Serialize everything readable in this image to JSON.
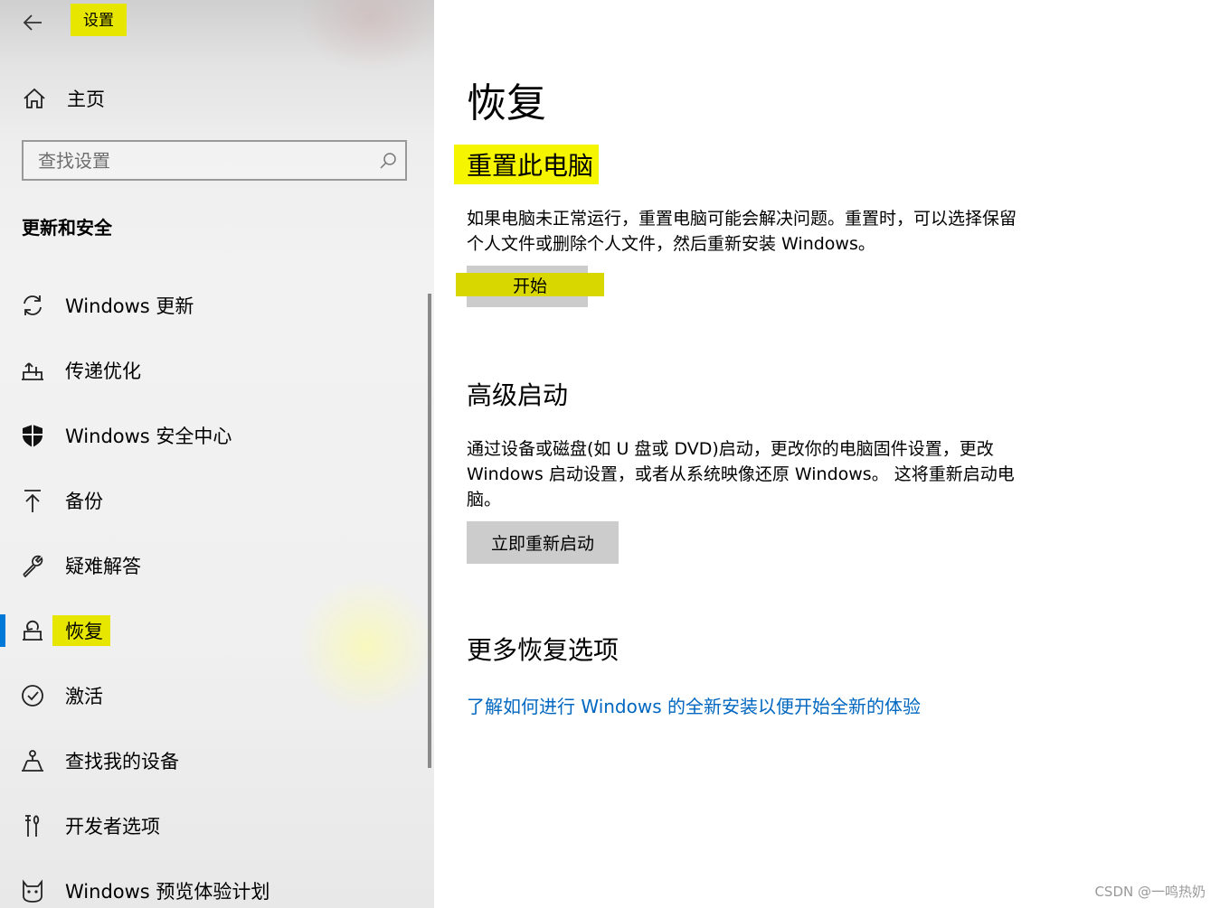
{
  "window": {
    "title": "设置"
  },
  "sidebar": {
    "home_label": "主页",
    "search_placeholder": "查找设置",
    "section_title": "更新和安全",
    "items": [
      {
        "label": "Windows 更新",
        "icon": "refresh-icon"
      },
      {
        "label": "传递优化",
        "icon": "delivery-optimization-icon"
      },
      {
        "label": "Windows 安全中心",
        "icon": "shield-icon"
      },
      {
        "label": "备份",
        "icon": "upload-arrow-icon"
      },
      {
        "label": "疑难解答",
        "icon": "wrench-icon"
      },
      {
        "label": "恢复",
        "icon": "recovery-icon",
        "selected": true
      },
      {
        "label": "激活",
        "icon": "check-circle-icon"
      },
      {
        "label": "查找我的设备",
        "icon": "find-device-icon"
      },
      {
        "label": "开发者选项",
        "icon": "developer-tools-icon"
      },
      {
        "label": "Windows 预览体验计划",
        "icon": "insider-cat-icon"
      }
    ]
  },
  "main": {
    "title": "恢复",
    "reset": {
      "heading": "重置此电脑",
      "description_line1": "如果电脑未正常运行，重置电脑可能会解决问题。重置时，可以选择保留",
      "description_line2": "个人文件或删除个人文件，然后重新安装 Windows。",
      "button": "开始"
    },
    "advanced": {
      "heading": "高级启动",
      "description_line1": "通过设备或磁盘(如 U 盘或 DVD)启动，更改你的电脑固件设置，更改",
      "description_line2": "Windows 启动设置，或者从系统映像还原 Windows。 这将重新启动电",
      "description_line3": "脑。",
      "button": "立即重新启动"
    },
    "more": {
      "heading": "更多恢复选项",
      "link": "了解如何进行 Windows 的全新安装以便开始全新的体验"
    }
  },
  "watermark": "CSDN @一鸣热奶",
  "colors": {
    "accent": "#0078d7",
    "highlight": "#e6e600",
    "link": "#0067c0"
  }
}
